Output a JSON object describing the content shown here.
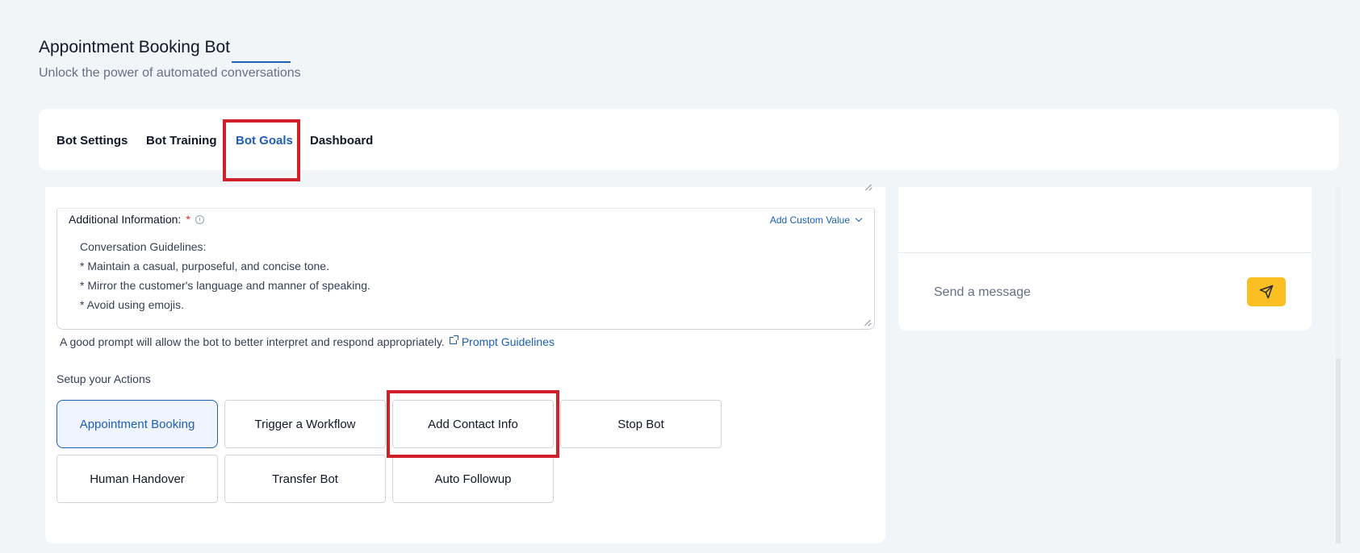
{
  "header": {
    "title": "Appointment Booking Bot",
    "subtitle": "Unlock the power of automated conversations"
  },
  "tabs": [
    {
      "label": "Bot Settings"
    },
    {
      "label": "Bot Training"
    },
    {
      "label": "Bot Goals",
      "active": true
    },
    {
      "label": "Dashboard"
    }
  ],
  "form": {
    "additional_info_label": "Additional Information:",
    "required_mark": "*",
    "add_custom_value": "Add Custom Value",
    "guidelines": [
      "Conversation Guidelines:",
      "* Maintain a casual, purposeful, and concise tone.",
      "* Mirror the customer's language and manner of speaking.",
      "* Avoid using emojis."
    ],
    "help_text": "A good prompt will allow the bot to better interpret and respond appropriately.",
    "prompt_link": "Prompt Guidelines"
  },
  "actions": {
    "title": "Setup your Actions",
    "items": [
      {
        "label": "Appointment Booking",
        "selected": true
      },
      {
        "label": "Trigger a Workflow"
      },
      {
        "label": "Add Contact Info"
      },
      {
        "label": "Stop Bot"
      },
      {
        "label": "Human Handover"
      },
      {
        "label": "Transfer Bot"
      },
      {
        "label": "Auto Followup"
      }
    ]
  },
  "chat": {
    "placeholder": "Send a message",
    "send_icon": "send-icon"
  },
  "colors": {
    "accent": "#1d5fb4",
    "send_button": "#fbbf24",
    "highlight": "#d0202a"
  }
}
